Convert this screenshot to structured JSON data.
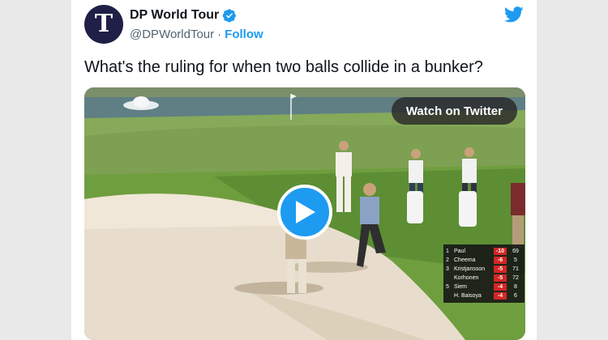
{
  "tweet": {
    "display_name": "DP World Tour",
    "handle": "@DPWorldTour",
    "separator": "·",
    "follow_label": "Follow",
    "text": "What's the ruling for when two balls collide in a bunker?",
    "avatar_letter": "T"
  },
  "media": {
    "watch_label": "Watch on Twitter",
    "icons": [
      "play-icon",
      "twitter-bird-icon",
      "verified-badge-icon"
    ]
  },
  "leaderboard": [
    {
      "pos": "1",
      "name": "Paul",
      "score": "-10",
      "round": "69"
    },
    {
      "pos": "2",
      "name": "Cheema",
      "score": "-6",
      "round": "5"
    },
    {
      "pos": "3",
      "name": "Kristjansson",
      "score": "-5",
      "round": "71"
    },
    {
      "pos": "",
      "name": "Korhonen",
      "score": "-5",
      "round": "72"
    },
    {
      "pos": "5",
      "name": "Siem",
      "score": "-4",
      "round": "8"
    },
    {
      "pos": "",
      "name": "H. Baisoya",
      "score": "-4",
      "round": "6"
    }
  ],
  "colors": {
    "accent": "#1d9bf0",
    "avatar_bg": "#1f1f47",
    "score_red": "#d32626"
  }
}
